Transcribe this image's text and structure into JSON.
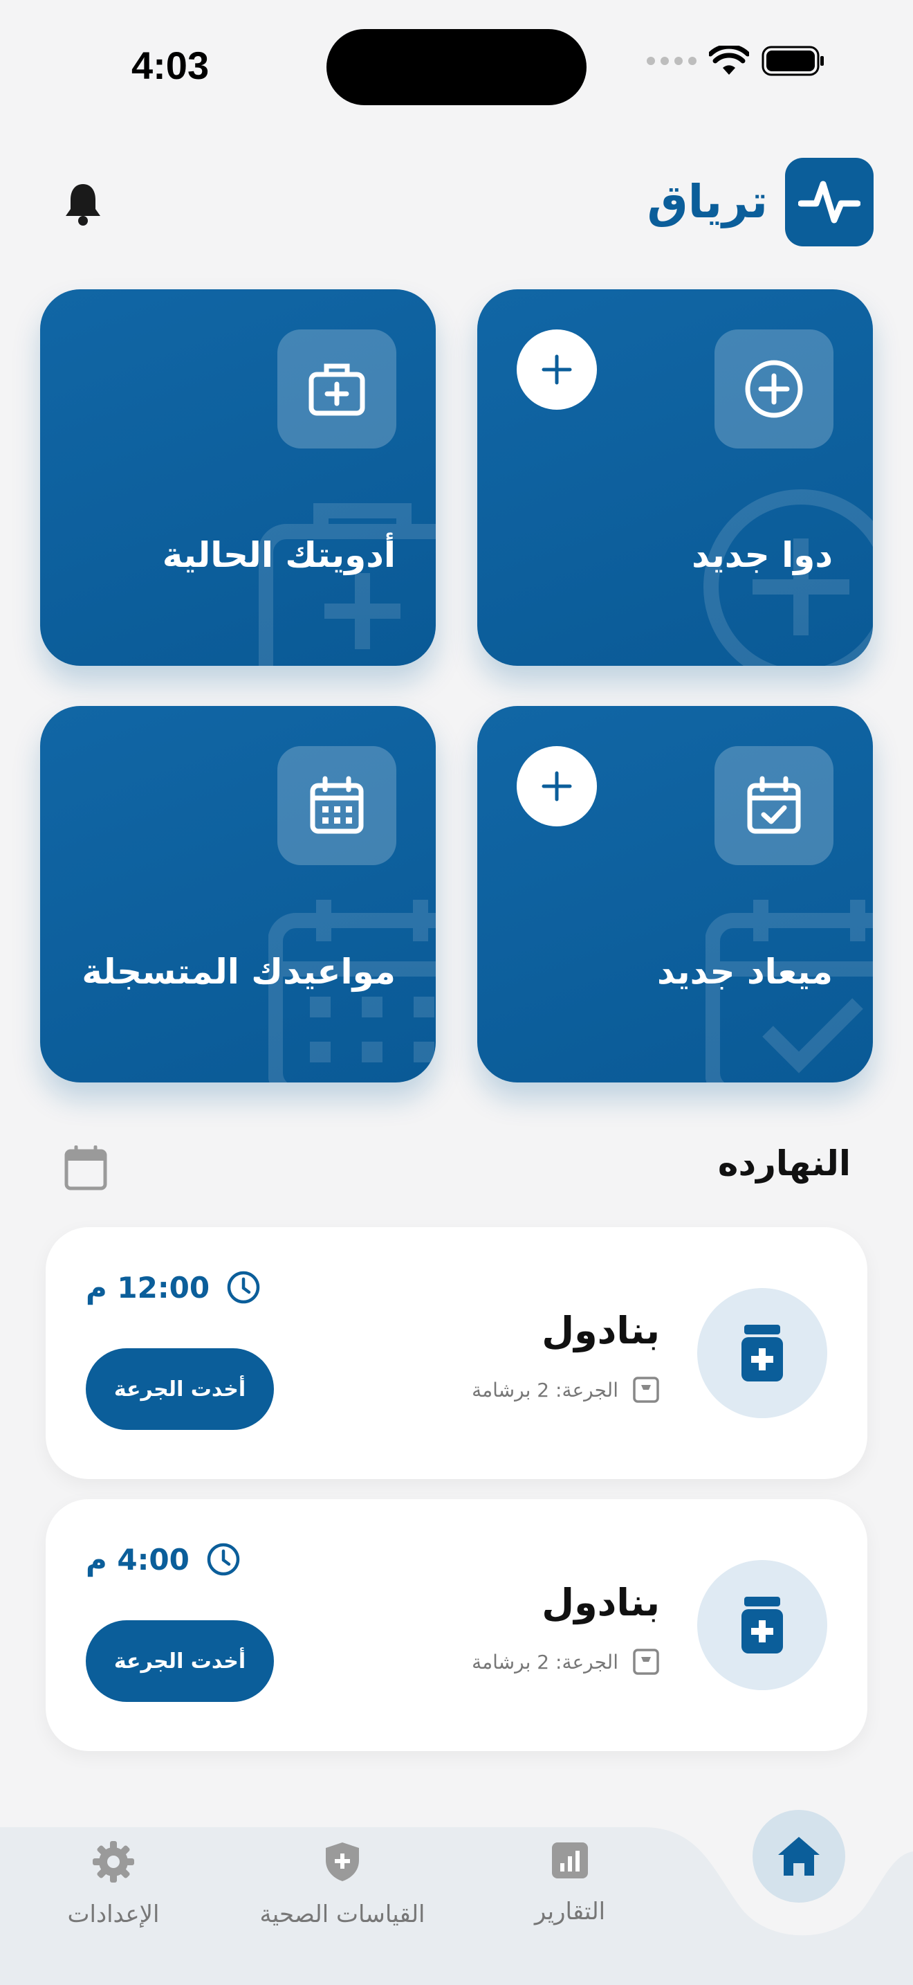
{
  "status_bar": {
    "time": "4:03"
  },
  "header": {
    "app_name": "ترياق"
  },
  "cards": [
    {
      "label": "دوا جديد",
      "icon": "plus-circle-icon",
      "has_plus": true
    },
    {
      "label": "أدويتك الحالية",
      "icon": "first-aid-kit-icon",
      "has_plus": false
    },
    {
      "label": "ميعاد جديد",
      "icon": "calendar-check-icon",
      "has_plus": true
    },
    {
      "label": "مواعيدك المتسجلة",
      "icon": "calendar-grid-icon",
      "has_plus": false
    }
  ],
  "today": {
    "title": "النهارده",
    "doses": [
      {
        "name": "بنادول",
        "dose": "الجرعة: 2 برشامة",
        "time": "12:00 م",
        "button": "أخدت الجرعة"
      },
      {
        "name": "بنادول",
        "dose": "الجرعة: 2 برشامة",
        "time": "4:00 م",
        "button": "أخدت الجرعة"
      }
    ]
  },
  "nav": {
    "reports": "التقارير",
    "health": "القياسات الصحية",
    "settings": "الإعدادات"
  },
  "colors": {
    "primary": "#0b5e9a",
    "background": "#f4f4f5",
    "nav_bg": "#e8ecf0"
  }
}
